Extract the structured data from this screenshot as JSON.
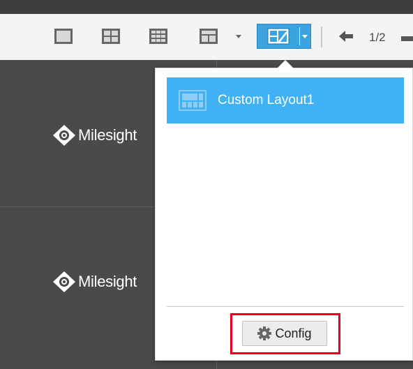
{
  "toolbar": {
    "layout_buttons": [
      {
        "icon": "single-view-icon"
      },
      {
        "icon": "quad-view-icon"
      },
      {
        "icon": "nine-view-icon"
      },
      {
        "icon": "custom-split-view-icon"
      }
    ],
    "custom_layout_button": {
      "icon": "custom-layout-edit-icon",
      "active": true
    },
    "pagination": {
      "current": "1/2"
    }
  },
  "video_cells": [
    {
      "brand": "Milesight"
    },
    {
      "brand": "Milesight"
    }
  ],
  "layout_menu": {
    "items": [
      {
        "label": "Custom Layout1",
        "selected": true,
        "icon": "layout-grid-icon"
      }
    ],
    "config_label": "Config",
    "config_icon": "gear-icon"
  },
  "colors": {
    "accent": "#3fb1f4",
    "highlight": "#e8001c",
    "video_bg": "#4a4a4a"
  }
}
